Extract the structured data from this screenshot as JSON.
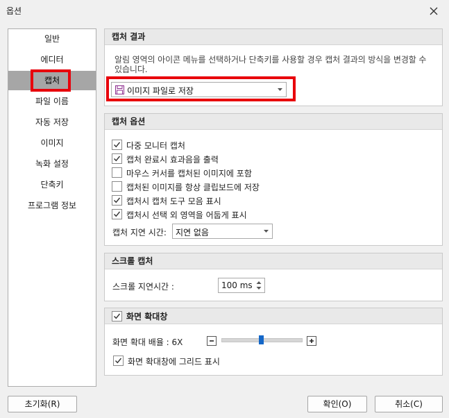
{
  "window": {
    "title": "옵션"
  },
  "sidebar": {
    "items": [
      {
        "label": "일반"
      },
      {
        "label": "에디터"
      },
      {
        "label": "캡처"
      },
      {
        "label": "파일 이름"
      },
      {
        "label": "자동 저장"
      },
      {
        "label": "이미지"
      },
      {
        "label": "녹화 설정"
      },
      {
        "label": "단축키"
      },
      {
        "label": "프로그램 정보"
      }
    ],
    "selected": "캡처"
  },
  "capture_result": {
    "header": "캡처 결과",
    "description": "알림 영역의 아이콘 메뉴를 선택하거나 단축키를 사용할 경우 캡처 결과의 방식을 변경할 수 있습니다.",
    "dropdown_value": "이미지 파일로 저장",
    "dropdown_icon": "floppy-disk-icon"
  },
  "capture_options": {
    "header": "캡처 옵션",
    "checkboxes": [
      {
        "label": "다중 모니터 캡처",
        "checked": true
      },
      {
        "label": "캡처 완료시 효과음을 출력",
        "checked": true
      },
      {
        "label": "마우스 커서를 캡처된 이미지에 포함",
        "checked": false
      },
      {
        "label": "캡처된 이미지를 항상 클립보드에 저장",
        "checked": false
      },
      {
        "label": "캡처시 캡처 도구 모음 표시",
        "checked": true
      },
      {
        "label": "캡처시 선택 외 영역을 어둡게 표시",
        "checked": true
      }
    ],
    "delay_label": "캡처 지연 시간:",
    "delay_value": "지연 없음"
  },
  "scroll_capture": {
    "header": "스크롤 캡처",
    "delay_label": "스크롤 지연시간 :",
    "delay_value": "100 ms"
  },
  "magnifier": {
    "header": "화면 확대창",
    "enabled": true,
    "zoom_label": "화면 확대 배율 : 6X",
    "zoom_level": 6,
    "grid_label": "화면 확대창에 그리드 표시",
    "grid_checked": true
  },
  "footer": {
    "reset_label": "초기화(R)",
    "ok_label": "확인(O)",
    "cancel_label": "취소(C)"
  },
  "colors": {
    "highlight": "#e8000b",
    "slider_thumb": "#1467c8",
    "selected_bg": "#a6a6a6",
    "dropdown_icon": "#8b2a8c"
  }
}
